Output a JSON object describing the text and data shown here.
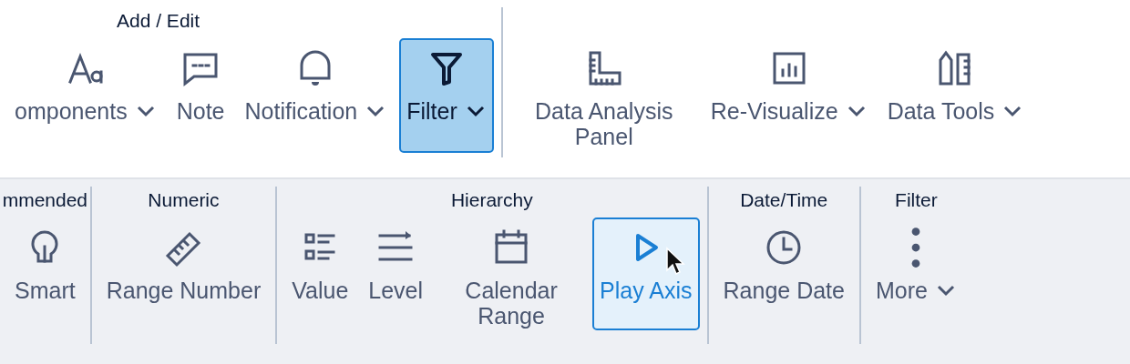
{
  "top_ribbon": {
    "groups": [
      {
        "label": "Add / Edit",
        "buttons": [
          {
            "label": "omponents",
            "kind": "text",
            "dropdown": true,
            "selected": false
          },
          {
            "label": "Note",
            "kind": "note",
            "dropdown": false,
            "selected": false
          },
          {
            "label": "Notification",
            "kind": "bell",
            "dropdown": true,
            "selected": false
          },
          {
            "label": "Filter",
            "kind": "filter",
            "dropdown": true,
            "selected": true
          }
        ]
      },
      {
        "buttons": [
          {
            "label": "Data Analysis Panel",
            "kind": "panel",
            "dropdown": false,
            "selected": false
          },
          {
            "label": "Re-Visualize",
            "kind": "chart",
            "dropdown": true,
            "selected": false
          },
          {
            "label": "Data Tools",
            "kind": "tools",
            "dropdown": true,
            "selected": false
          }
        ]
      }
    ]
  },
  "bottom_ribbon": {
    "groups": [
      {
        "label": "mmended",
        "buttons": [
          {
            "label": "Smart",
            "kind": "bulb",
            "dropdown": false,
            "selected": false
          }
        ]
      },
      {
        "label": "Numeric",
        "buttons": [
          {
            "label": "Range Number",
            "kind": "ruler",
            "dropdown": false,
            "selected": false
          }
        ]
      },
      {
        "label": "Hierarchy",
        "buttons": [
          {
            "label": "Value",
            "kind": "list",
            "dropdown": false,
            "selected": false
          },
          {
            "label": "Level",
            "kind": "lines",
            "dropdown": false,
            "selected": false
          },
          {
            "label": "Calendar Range",
            "kind": "calendar",
            "dropdown": false,
            "selected": false
          },
          {
            "label": "Play Axis",
            "kind": "play",
            "dropdown": false,
            "selected": true,
            "pointer": true
          }
        ]
      },
      {
        "label": "Date/Time",
        "buttons": [
          {
            "label": "Range Date",
            "kind": "clock",
            "dropdown": false,
            "selected": false
          }
        ]
      },
      {
        "label": "Filter",
        "buttons": [
          {
            "label": "More",
            "kind": "dots",
            "dropdown": true,
            "selected": false
          }
        ]
      }
    ]
  }
}
